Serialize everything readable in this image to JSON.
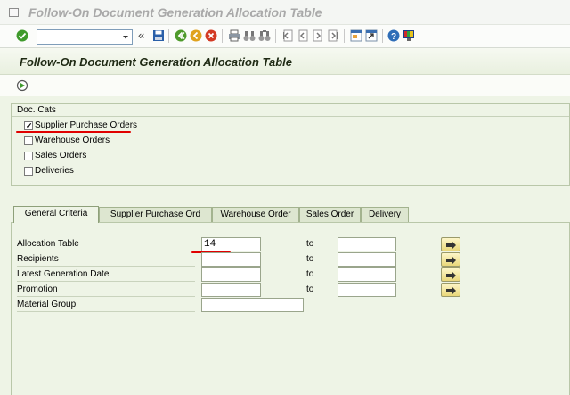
{
  "window": {
    "title": "Follow-On Document Generation Allocation Table"
  },
  "toolbar": {
    "command_field_value": "",
    "icons": [
      "enter-icon",
      "save-icon",
      "back-icon",
      "exit-icon",
      "cancel-icon",
      "print-icon",
      "find-icon",
      "find-next-icon",
      "first-page-icon",
      "previous-page-icon",
      "next-page-icon",
      "last-page-icon",
      "create-session-icon",
      "shortcut-icon",
      "help-icon",
      "customize-layout-icon"
    ]
  },
  "screen": {
    "title": "Follow-On Document Generation Allocation Table"
  },
  "doc_cats": {
    "title": "Doc. Cats",
    "items": [
      {
        "label": "Supplier Purchase Orders",
        "checked": true
      },
      {
        "label": "Warehouse Orders",
        "checked": false
      },
      {
        "label": "Sales Orders",
        "checked": false
      },
      {
        "label": "Deliveries",
        "checked": false
      }
    ]
  },
  "tabs": [
    {
      "label": "General Criteria",
      "active": true
    },
    {
      "label": "Supplier Purchase Ord",
      "active": false
    },
    {
      "label": "Warehouse Order",
      "active": false
    },
    {
      "label": "Sales Order",
      "active": false
    },
    {
      "label": "Delivery",
      "active": false
    }
  ],
  "criteria": {
    "to_label": "to",
    "rows": [
      {
        "label": "Allocation Table",
        "from": "14",
        "to": ""
      },
      {
        "label": "Recipients",
        "from": "",
        "to": ""
      },
      {
        "label": "Latest Generation Date",
        "from": "",
        "to": ""
      },
      {
        "label": "Promotion",
        "from": "",
        "to": ""
      },
      {
        "label": "Material Group",
        "from": ""
      }
    ]
  },
  "colors": {
    "annotation": "#e00000",
    "panel_bg": "#eef4e6"
  }
}
